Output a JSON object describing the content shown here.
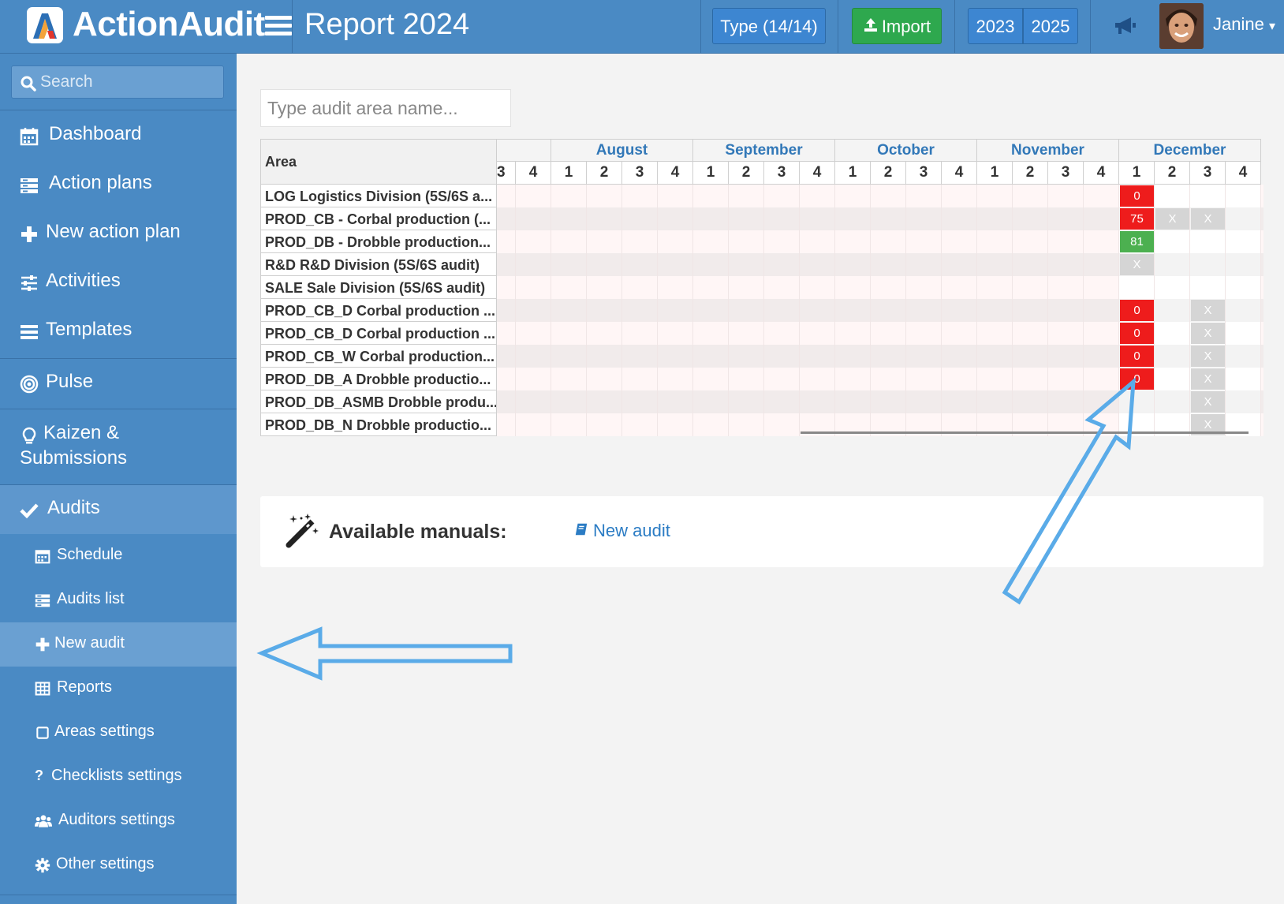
{
  "header": {
    "app_name": "ActionAudit",
    "page_title": "Report 2024",
    "type_button": "Type (14/14)",
    "import_button": "Import",
    "year_prev": "2023",
    "year_next": "2025",
    "username": "Janine",
    "username_caret": "▾",
    "icons": [
      "hamburger-menu-icon",
      "upload-icon",
      "megaphone-icon",
      "avatar"
    ]
  },
  "sidebar": {
    "search_placeholder": "Search",
    "items": [
      {
        "label": "Dashboard",
        "icon": "calendar-icon"
      },
      {
        "label": "Action plans",
        "icon": "list-icon"
      },
      {
        "label": "New action plan",
        "icon": "plus-icon"
      },
      {
        "label": "Activities",
        "icon": "sliders-icon"
      },
      {
        "label": "Templates",
        "icon": "bars-icon"
      },
      {
        "label": "Pulse",
        "icon": "target-icon"
      },
      {
        "label": "Kaizen &",
        "label2": "Submissions",
        "icon": "lightbulb-icon"
      },
      {
        "label": "Audits",
        "icon": "check-icon"
      }
    ],
    "sub_items": [
      {
        "label": "Schedule",
        "icon": "calendar-icon"
      },
      {
        "label": "Audits list",
        "icon": "list-icon"
      },
      {
        "label": "New audit",
        "icon": "plus-icon"
      },
      {
        "label": "Reports",
        "icon": "table-icon"
      },
      {
        "label": "Areas settings",
        "icon": "square-icon"
      },
      {
        "label": "Checklists settings",
        "icon": "question-icon"
      },
      {
        "label": "Auditors settings",
        "icon": "users-icon"
      },
      {
        "label": "Other settings",
        "icon": "gear-icon"
      }
    ]
  },
  "main": {
    "area_search_placeholder": "Type audit area name...",
    "area_header": "Area",
    "months": [
      "August",
      "September",
      "October",
      "November",
      "December"
    ],
    "week_labels": [
      "3",
      "4",
      "1",
      "2",
      "3",
      "4",
      "1",
      "2",
      "3",
      "4",
      "1",
      "2",
      "3",
      "4",
      "1",
      "2",
      "3",
      "4",
      "1",
      "2",
      "3",
      "4"
    ],
    "rows": [
      {
        "area": "LOG Logistics Division (5S/6S a...",
        "dec": [
          "0",
          "",
          "",
          ""
        ],
        "dec_status": [
          "red",
          "white",
          "white",
          "white"
        ]
      },
      {
        "area": "PROD_CB - Corbal production (...",
        "dec": [
          "75",
          "X",
          "X",
          ""
        ],
        "dec_status": [
          "red",
          "grey",
          "grey",
          "none"
        ]
      },
      {
        "area": "PROD_DB - Drobble production...",
        "dec": [
          "81",
          "",
          "",
          ""
        ],
        "dec_status": [
          "green",
          "white",
          "white",
          "white"
        ]
      },
      {
        "area": "R&D R&D Division (5S/6S audit)",
        "dec": [
          "X",
          "",
          "",
          ""
        ],
        "dec_status": [
          "grey",
          "none",
          "none",
          "none"
        ]
      },
      {
        "area": "SALE Sale Division (5S/6S audit)",
        "dec": [
          "",
          "",
          "",
          ""
        ],
        "dec_status": [
          "white",
          "white",
          "white",
          "white"
        ]
      },
      {
        "area": "PROD_CB_D Corbal production ...",
        "dec": [
          "0",
          "",
          "X",
          ""
        ],
        "dec_status": [
          "red",
          "none",
          "grey",
          "none"
        ]
      },
      {
        "area": "PROD_CB_D Corbal production ...",
        "dec": [
          "0",
          "",
          "X",
          ""
        ],
        "dec_status": [
          "red",
          "white",
          "grey",
          "white"
        ]
      },
      {
        "area": "PROD_CB_W Corbal production...",
        "dec": [
          "0",
          "",
          "X",
          ""
        ],
        "dec_status": [
          "red",
          "none",
          "grey",
          "none"
        ]
      },
      {
        "area": "PROD_DB_A Drobble productio...",
        "dec": [
          "0",
          "",
          "X",
          ""
        ],
        "dec_status": [
          "red",
          "white",
          "grey",
          "white"
        ]
      },
      {
        "area": "PROD_DB_ASMB Drobble produ...",
        "dec": [
          "",
          "",
          "X",
          ""
        ],
        "dec_status": [
          "none",
          "none",
          "grey",
          "none"
        ]
      },
      {
        "area": "PROD_DB_N Drobble productio...",
        "dec": [
          "",
          "",
          "X",
          ""
        ],
        "dec_status": [
          "none",
          "white",
          "grey",
          "white"
        ]
      }
    ],
    "manuals_label": "Available manuals:",
    "new_audit_link": "New audit"
  },
  "colors": {
    "primary": "#4a8ac4",
    "import_green": "#2ea84e",
    "status_red": "#ee1c1c",
    "status_green": "#4cb050",
    "status_grey": "#d5d5d5",
    "link": "#2b7cc4",
    "annotation_arrow": "#5aabe8"
  }
}
